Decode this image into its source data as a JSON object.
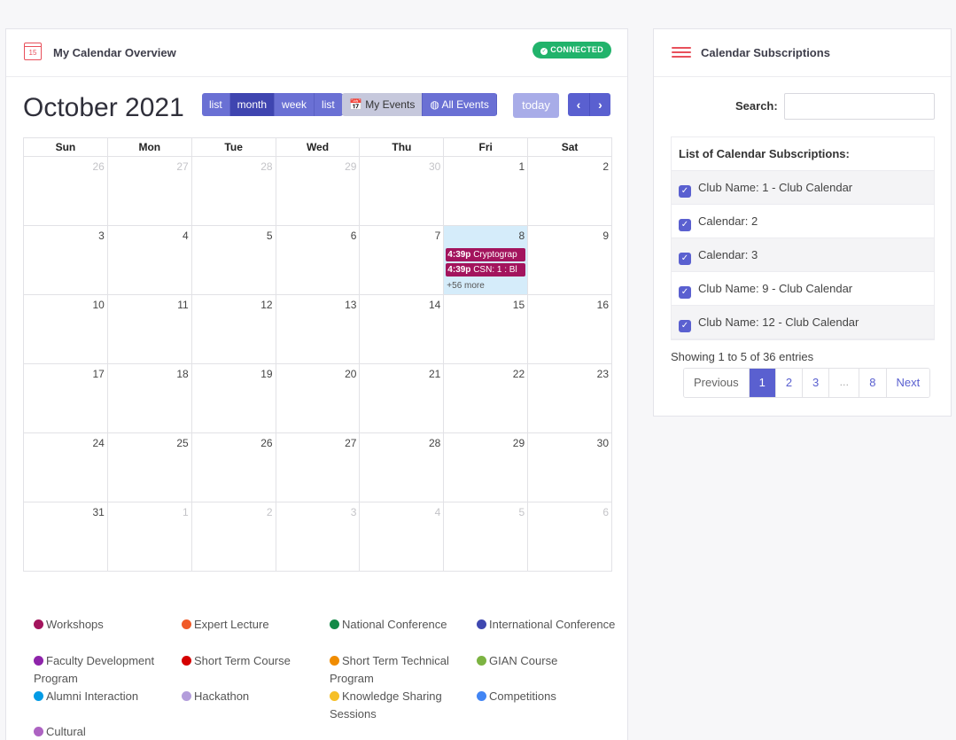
{
  "overview": {
    "title": "My Calendar Overview",
    "icon_text": "15",
    "badge": "CONNECTED",
    "month_title": "October 2021",
    "views": [
      "list",
      "month",
      "week",
      "list"
    ],
    "active_view": "month",
    "event_filters": [
      "My Events",
      "All Events"
    ],
    "today_label": "today",
    "weekdays": [
      "Sun",
      "Mon",
      "Tue",
      "Wed",
      "Thu",
      "Fri",
      "Sat"
    ],
    "weeks": [
      [
        {
          "n": "26",
          "o": true
        },
        {
          "n": "27",
          "o": true
        },
        {
          "n": "28",
          "o": true
        },
        {
          "n": "29",
          "o": true
        },
        {
          "n": "30",
          "o": true
        },
        {
          "n": "1"
        },
        {
          "n": "2"
        }
      ],
      [
        {
          "n": "3"
        },
        {
          "n": "4"
        },
        {
          "n": "5"
        },
        {
          "n": "6"
        },
        {
          "n": "7"
        },
        {
          "n": "8",
          "today": true
        },
        {
          "n": "9"
        }
      ],
      [
        {
          "n": "10"
        },
        {
          "n": "11"
        },
        {
          "n": "12"
        },
        {
          "n": "13"
        },
        {
          "n": "14"
        },
        {
          "n": "15"
        },
        {
          "n": "16"
        }
      ],
      [
        {
          "n": "17"
        },
        {
          "n": "18"
        },
        {
          "n": "19"
        },
        {
          "n": "20"
        },
        {
          "n": "21"
        },
        {
          "n": "22"
        },
        {
          "n": "23"
        }
      ],
      [
        {
          "n": "24"
        },
        {
          "n": "25"
        },
        {
          "n": "26"
        },
        {
          "n": "27"
        },
        {
          "n": "28"
        },
        {
          "n": "29"
        },
        {
          "n": "30"
        }
      ],
      [
        {
          "n": "31"
        },
        {
          "n": "1",
          "o": true
        },
        {
          "n": "2",
          "o": true
        },
        {
          "n": "3",
          "o": true
        },
        {
          "n": "4",
          "o": true
        },
        {
          "n": "5",
          "o": true
        },
        {
          "n": "6",
          "o": true
        }
      ]
    ],
    "today_events": [
      {
        "time": "4:39p",
        "title": "Cryptograp"
      },
      {
        "time": "4:39p",
        "title": "CSN: 1 : Bl"
      }
    ],
    "more_link": "+56 more",
    "event_color": "#a3145d"
  },
  "legend": [
    {
      "label": "Workshops",
      "color": "#a3145d"
    },
    {
      "label": "Expert Lecture",
      "color": "#f05a28"
    },
    {
      "label": "National Conference",
      "color": "#138a47"
    },
    {
      "label": "International Conference",
      "color": "#3f48b0"
    },
    {
      "label": "Faculty Development Program",
      "color": "#8e24aa"
    },
    {
      "label": "Short Term Course",
      "color": "#d50000"
    },
    {
      "label": "Short Term Technical Program",
      "color": "#f08c00"
    },
    {
      "label": "GIAN Course",
      "color": "#7cb342"
    },
    {
      "label": "Alumni Interaction",
      "color": "#039be5"
    },
    {
      "label": "Hackathon",
      "color": "#b39ddb"
    },
    {
      "label": "Knowledge Sharing Sessions",
      "color": "#f6bf26"
    },
    {
      "label": "Competitions",
      "color": "#4285f4"
    },
    {
      "label": "Cultural",
      "color": "#ad63c2"
    }
  ],
  "subscriptions": {
    "title": "Calendar Subscriptions",
    "search_label": "Search:",
    "search_value": "",
    "table_header": "List of Calendar Subscriptions:",
    "items": [
      "Club Name: 1 - Club Calendar",
      "Calendar: 2",
      "Calendar: 3",
      "Club Name: 9 - Club Calendar",
      "Club Name: 12 - Club Calendar"
    ],
    "showing": "Showing 1 to 5 of 36 entries",
    "pagination": {
      "previous": "Previous",
      "pages": [
        "1",
        "2",
        "3",
        "…",
        "8"
      ],
      "active": "1",
      "next": "Next"
    }
  }
}
